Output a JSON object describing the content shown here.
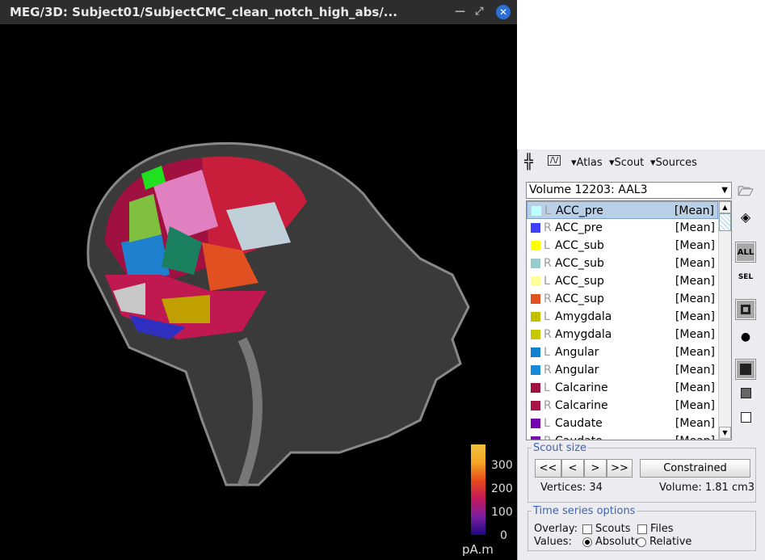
{
  "window": {
    "title": "MEG/3D: Subject01/SubjectCMC_clean_notch_high_abs/...",
    "minimize": "—",
    "restore": "⤢",
    "close": "✕"
  },
  "colorbar": {
    "ticks": [
      "300",
      "200",
      "100",
      "0"
    ],
    "unit": "pA.m"
  },
  "toolbar": {
    "atlas": "▾Atlas",
    "scout": "▾Scout",
    "sources": "▾Sources"
  },
  "atlas_select": {
    "value": "Volume 12203: AAL3"
  },
  "scouts": [
    {
      "side": "L",
      "name": "ACC_pre",
      "func": "[Mean]",
      "color": "#c0ffff",
      "selected": true
    },
    {
      "side": "R",
      "name": "ACC_pre",
      "func": "[Mean]",
      "color": "#4040ff"
    },
    {
      "side": "L",
      "name": "ACC_sub",
      "func": "[Mean]",
      "color": "#ffff00"
    },
    {
      "side": "R",
      "name": "ACC_sub",
      "func": "[Mean]",
      "color": "#99cccc"
    },
    {
      "side": "L",
      "name": "ACC_sup",
      "func": "[Mean]",
      "color": "#ffff99"
    },
    {
      "side": "R",
      "name": "ACC_sup",
      "func": "[Mean]",
      "color": "#e05020"
    },
    {
      "side": "L",
      "name": "Amygdala",
      "func": "[Mean]",
      "color": "#c0c000"
    },
    {
      "side": "R",
      "name": "Amygdala",
      "func": "[Mean]",
      "color": "#c8c800"
    },
    {
      "side": "L",
      "name": "Angular",
      "func": "[Mean]",
      "color": "#1080d0"
    },
    {
      "side": "R",
      "name": "Angular",
      "func": "[Mean]",
      "color": "#1888d8"
    },
    {
      "side": "L",
      "name": "Calcarine",
      "func": "[Mean]",
      "color": "#a01040"
    },
    {
      "side": "R",
      "name": "Calcarine",
      "func": "[Mean]",
      "color": "#a81448"
    },
    {
      "side": "L",
      "name": "Caudate",
      "func": "[Mean]",
      "color": "#7000b0"
    },
    {
      "side": "R",
      "name": "Caudate",
      "func": "[Mean]",
      "color": "#7808b8"
    }
  ],
  "side_tools": {
    "all": "ALL",
    "sel": "SEL"
  },
  "scout_size": {
    "legend": "Scout size",
    "buttons": [
      "<<",
      "<",
      ">",
      ">>"
    ],
    "constrained": "Constrained",
    "vertices": "Vertices: 34",
    "volume": "Volume: 1.81 cm3"
  },
  "time_series": {
    "legend": "Time series options",
    "overlay_label": "Overlay:",
    "scouts": "Scouts",
    "files": "Files",
    "values_label": "Values:",
    "absolute": "Absolute",
    "relative": "Relative",
    "scouts_checked": false,
    "files_checked": false,
    "values_selected": "Absolute"
  }
}
